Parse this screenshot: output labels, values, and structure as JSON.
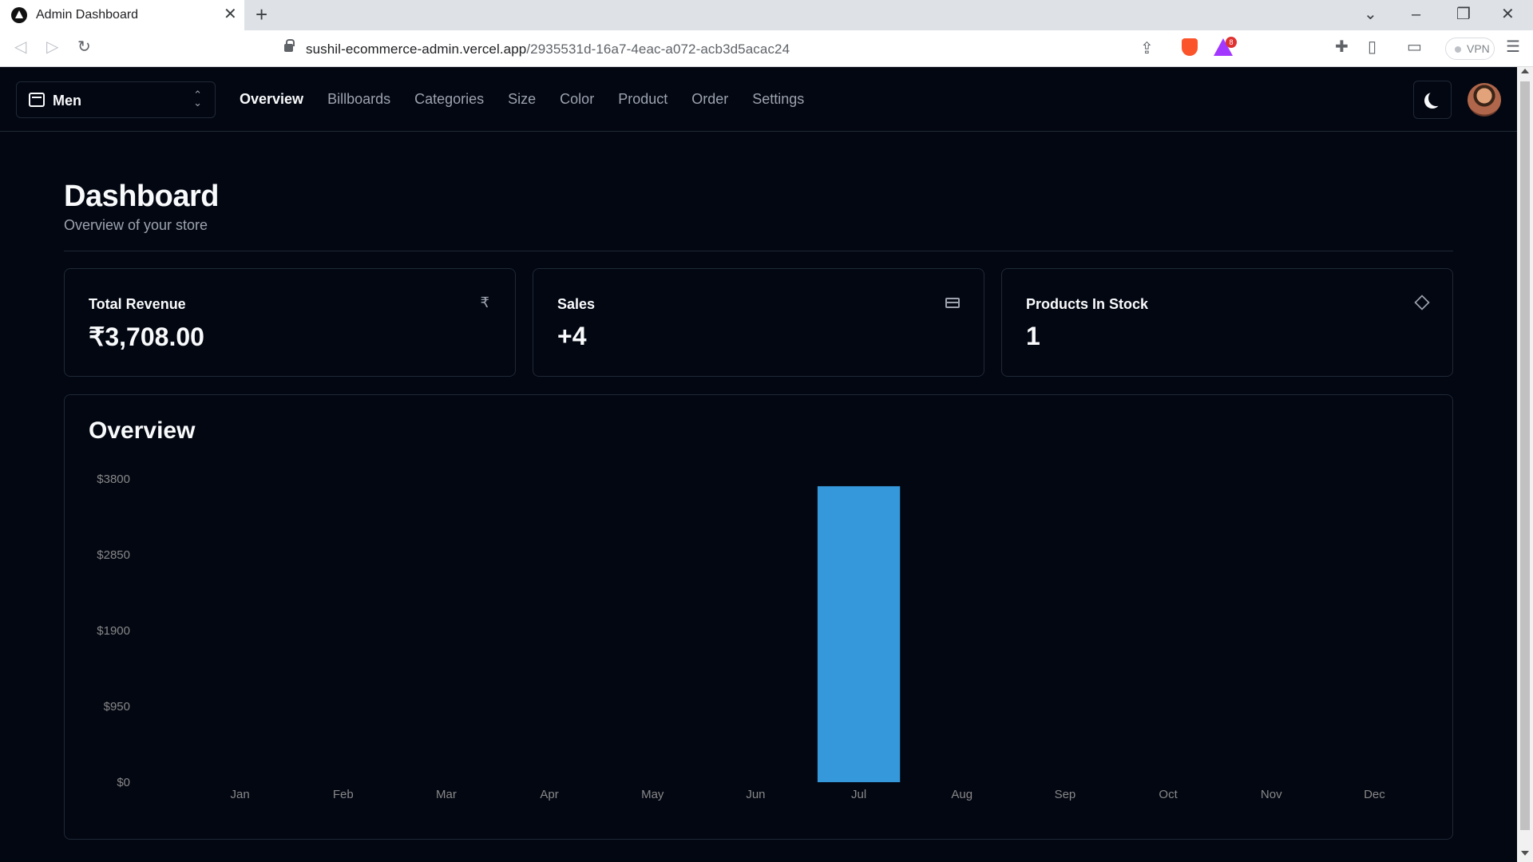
{
  "browser": {
    "tab_title": "Admin Dashboard",
    "url_host": "sushil-ecommerce-admin.vercel.app",
    "url_path": "/2935531d-16a7-4eac-a072-acb3d5acac24",
    "rewards_count": "8",
    "vpn_label": "VPN"
  },
  "nav": {
    "store": "Men",
    "links": [
      "Overview",
      "Billboards",
      "Categories",
      "Size",
      "Color",
      "Product",
      "Order",
      "Settings"
    ],
    "active": "Overview"
  },
  "page": {
    "title": "Dashboard",
    "subtitle": "Overview of your store"
  },
  "cards": [
    {
      "label": "Total Revenue",
      "value": "₹3,708.00",
      "icon": "rupee-icon"
    },
    {
      "label": "Sales",
      "value": "+4",
      "icon": "credit-card-icon"
    },
    {
      "label": "Products In Stock",
      "value": "1",
      "icon": "package-icon"
    }
  ],
  "overview": {
    "title": "Overview"
  },
  "colors": {
    "bar": "#3498db",
    "background": "#030712",
    "border": "#1f2937",
    "muted": "#9ca3af"
  },
  "chart_data": {
    "type": "bar",
    "categories": [
      "Jan",
      "Feb",
      "Mar",
      "Apr",
      "May",
      "Jun",
      "Jul",
      "Aug",
      "Sep",
      "Oct",
      "Nov",
      "Dec"
    ],
    "values": [
      0,
      0,
      0,
      0,
      0,
      0,
      3708,
      0,
      0,
      0,
      0,
      0
    ],
    "ylim": [
      0,
      3800
    ],
    "yticks": [
      0,
      950,
      1900,
      2850,
      3800
    ],
    "ytick_labels": [
      "$0",
      "$950",
      "$1900",
      "$2850",
      "$3800"
    ],
    "title": "",
    "xlabel": "",
    "ylabel": "",
    "grid": false
  }
}
